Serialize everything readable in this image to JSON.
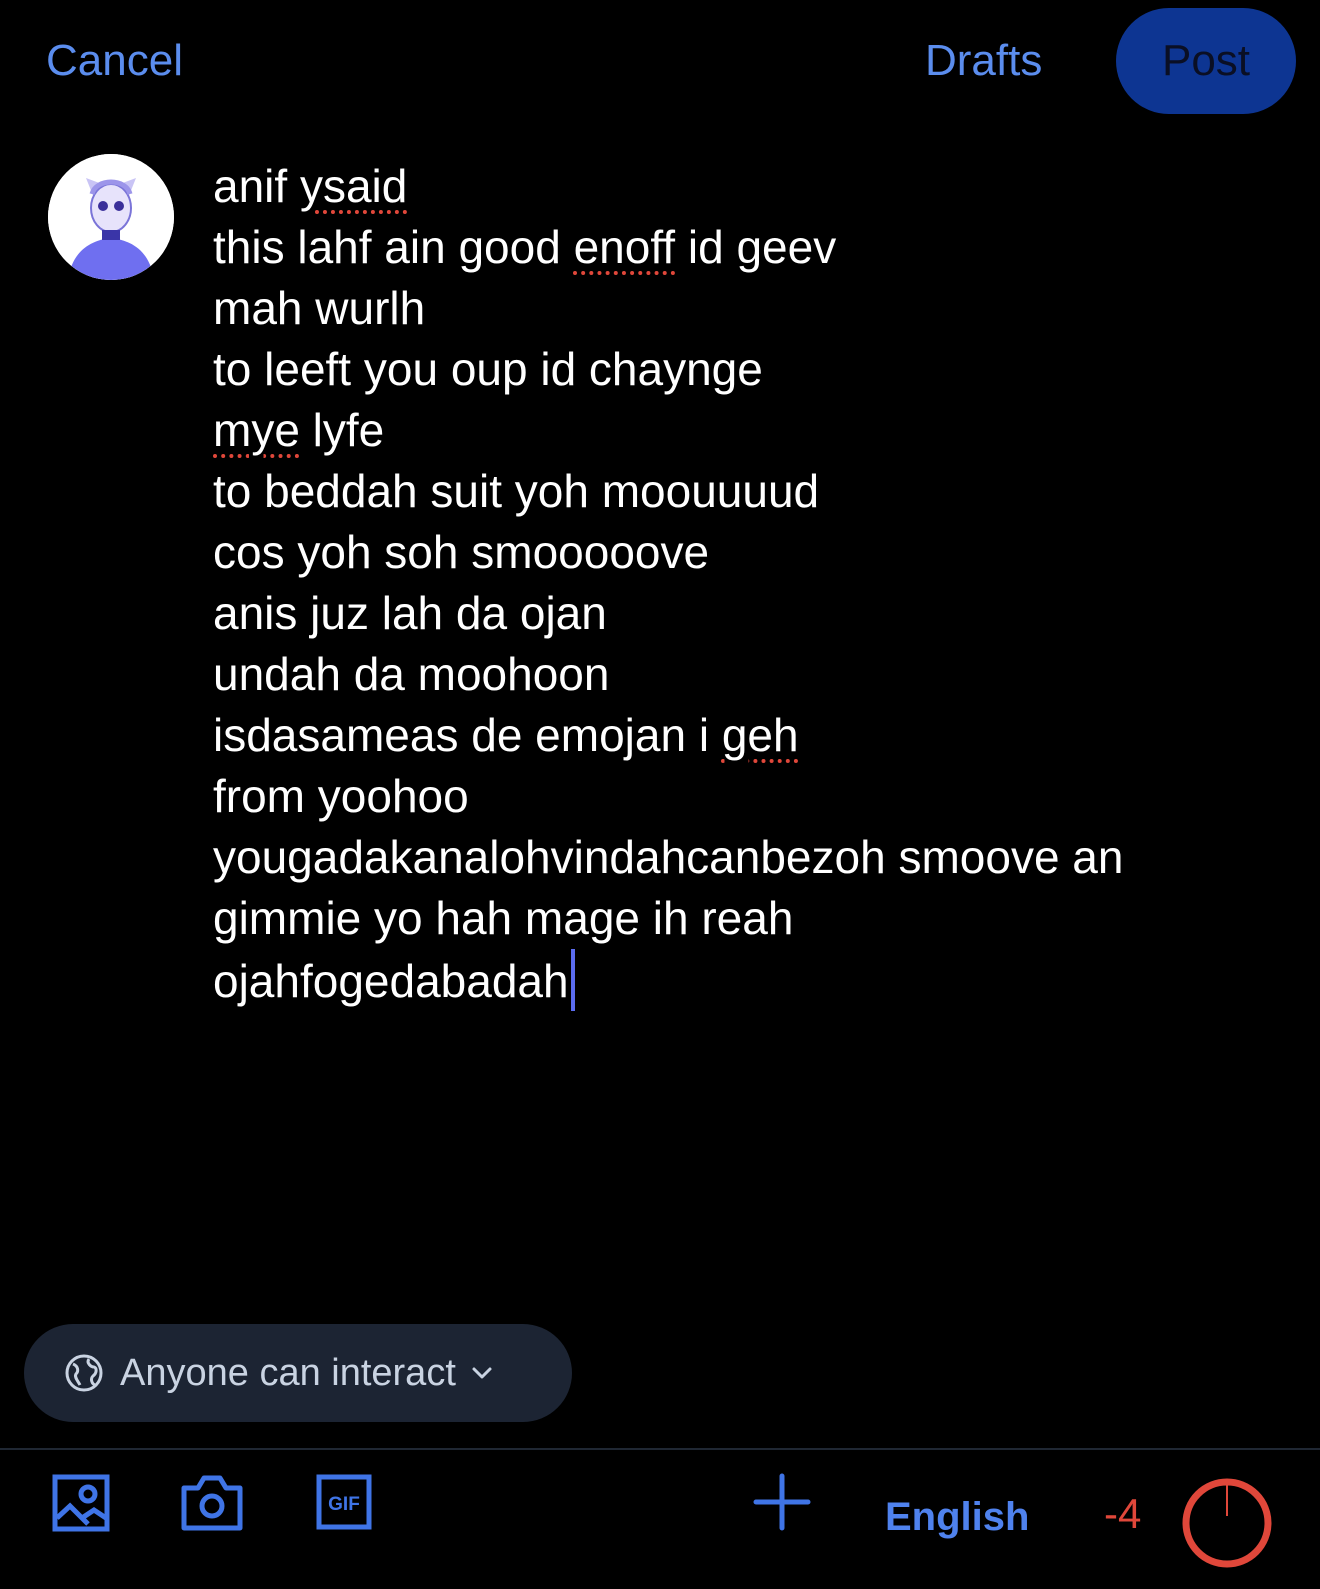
{
  "header": {
    "cancel_label": "Cancel",
    "drafts_label": "Drafts",
    "post_label": "Post"
  },
  "composer": {
    "lines": [
      [
        {
          "text": "anif "
        },
        {
          "text": "ysaid",
          "misspelled": true
        }
      ],
      [
        {
          "text": "this lahf ain good "
        },
        {
          "text": "enoff",
          "misspelled": true
        },
        {
          "text": " id geev"
        }
      ],
      [
        {
          "text": "mah wurlh"
        }
      ],
      [
        {
          "text": "to leeft you oup id chaynge"
        }
      ],
      [
        {
          "text": "mye",
          "misspelled": true
        },
        {
          "text": " lyfe"
        }
      ],
      [
        {
          "text": "to beddah suit yoh moouuuud"
        }
      ],
      [
        {
          "text": "cos yoh soh smooooove"
        }
      ],
      [
        {
          "text": "anis juz lah da ojan"
        }
      ],
      [
        {
          "text": "undah da moohoon"
        }
      ],
      [
        {
          "text": "isdasameas de emojan i "
        },
        {
          "text": "geh",
          "misspelled": true
        }
      ],
      [
        {
          "text": "from yoohoo"
        }
      ],
      [
        {
          "text": "yougadakanalohvindahcanbezoh smoove an"
        }
      ],
      [
        {
          "text": "gimmie yo hah mage ih reah"
        }
      ],
      [
        {
          "text": "ojahfogedabadah"
        }
      ]
    ]
  },
  "audience": {
    "label": "Anyone can interact",
    "icon": "globe-icon"
  },
  "toolbar": {
    "icons": [
      "image-icon",
      "camera-icon",
      "gif-icon",
      "plus-icon"
    ],
    "gif_text": "GIF",
    "language": "English",
    "char_counter": "-4",
    "char_limit_progress": 1.0
  },
  "colors": {
    "accent": "#5b8dee",
    "post_button": "#0d3592",
    "error": "#e0473a",
    "pill_bg": "#1c2433"
  }
}
